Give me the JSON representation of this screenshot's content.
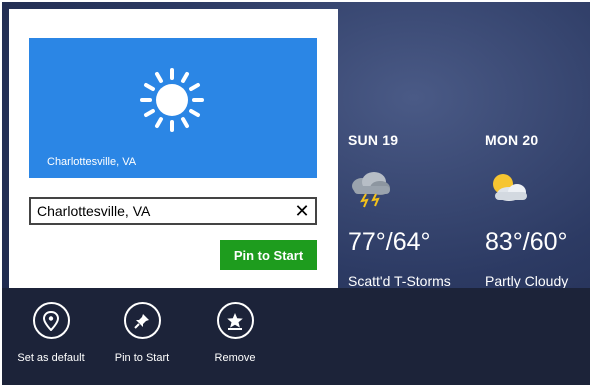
{
  "forecast": [
    {
      "day": "SUN 19",
      "icon": "thunderstorm-icon",
      "temp": "77°/64°",
      "condition": "Scatt'd T-Storms"
    },
    {
      "day": "MON 20",
      "icon": "partly-cloudy-icon",
      "temp": "83°/60°",
      "condition": "Partly Cloudy"
    }
  ],
  "flyout": {
    "tile": {
      "icon": "sun-icon",
      "label": "Charlottesville, VA",
      "color": "#2b86e5"
    },
    "input_value": "Charlottesville, VA",
    "clear_glyph": "✕",
    "pin_label": "Pin to Start",
    "pin_color": "#1e9c1e"
  },
  "appbar": {
    "commands": [
      {
        "icon": "location-pin-icon",
        "label": "Set as default"
      },
      {
        "icon": "pushpin-icon",
        "label": "Pin to Start"
      },
      {
        "icon": "remove-star-icon",
        "label": "Remove"
      }
    ]
  }
}
